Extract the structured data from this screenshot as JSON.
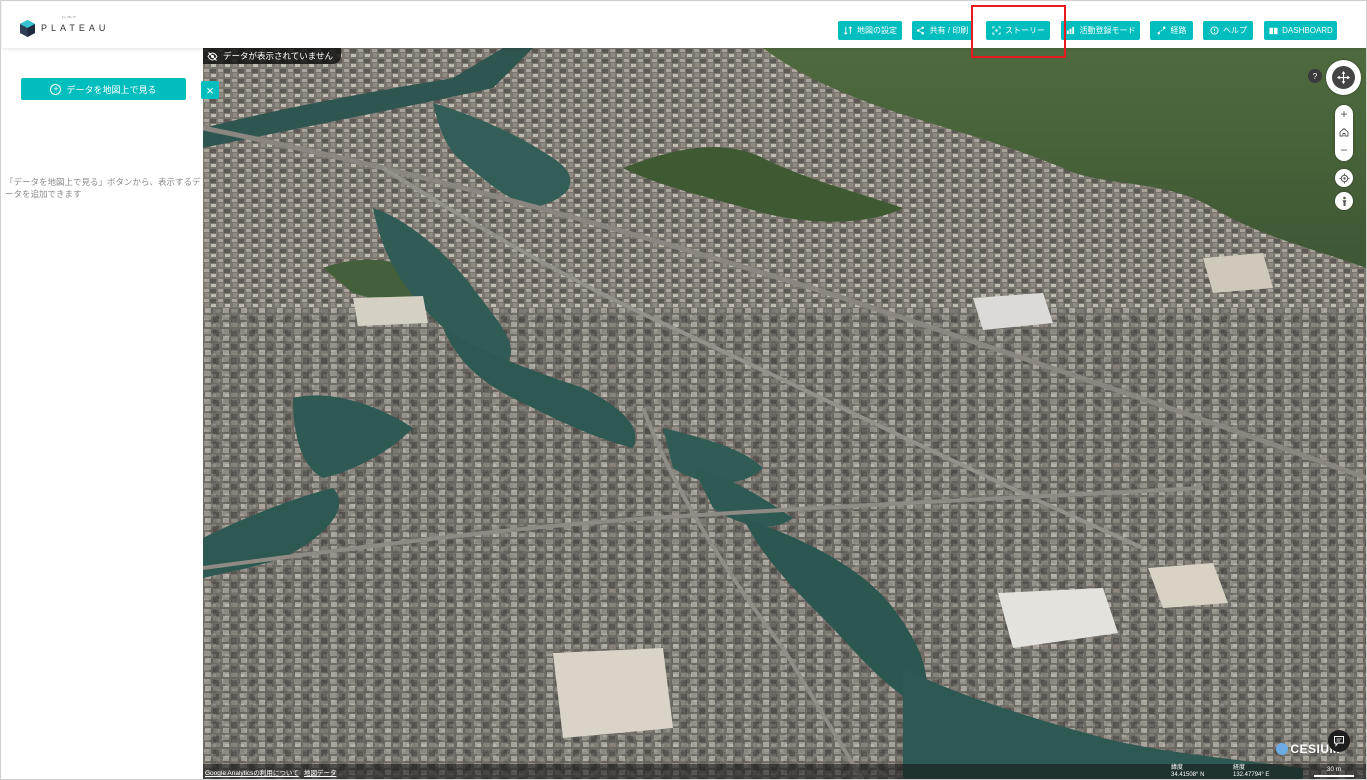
{
  "app": {
    "logo_text": "PLATEAU",
    "logo_sub": "by MLIT"
  },
  "toolbar": {
    "map_settings": "地図の設定",
    "share_print": "共有 / 印刷",
    "story": "ストーリー",
    "activity_mode": "活動登録モード",
    "route": "経路",
    "help": "ヘルプ",
    "dashboard": "DASHBOARD"
  },
  "sidebar": {
    "add_data_label": "データを地図上で見る",
    "hint": "「データを地図上で見る」ボタンから、表示するデータを追加できます"
  },
  "map": {
    "no_data_badge": "データが表示されていません",
    "help_label": "?",
    "footer_links": [
      "Google Analyticsの利用について",
      "地図データ"
    ],
    "lat": "34.41508° N",
    "lon": "132.47794° E",
    "lat_label": "緯度",
    "lon_label": "経度",
    "scale_label": "30 m",
    "cesium_label": "CESIUM"
  },
  "colors": {
    "accent": "#00bebe",
    "highlight": "#e8191f"
  }
}
